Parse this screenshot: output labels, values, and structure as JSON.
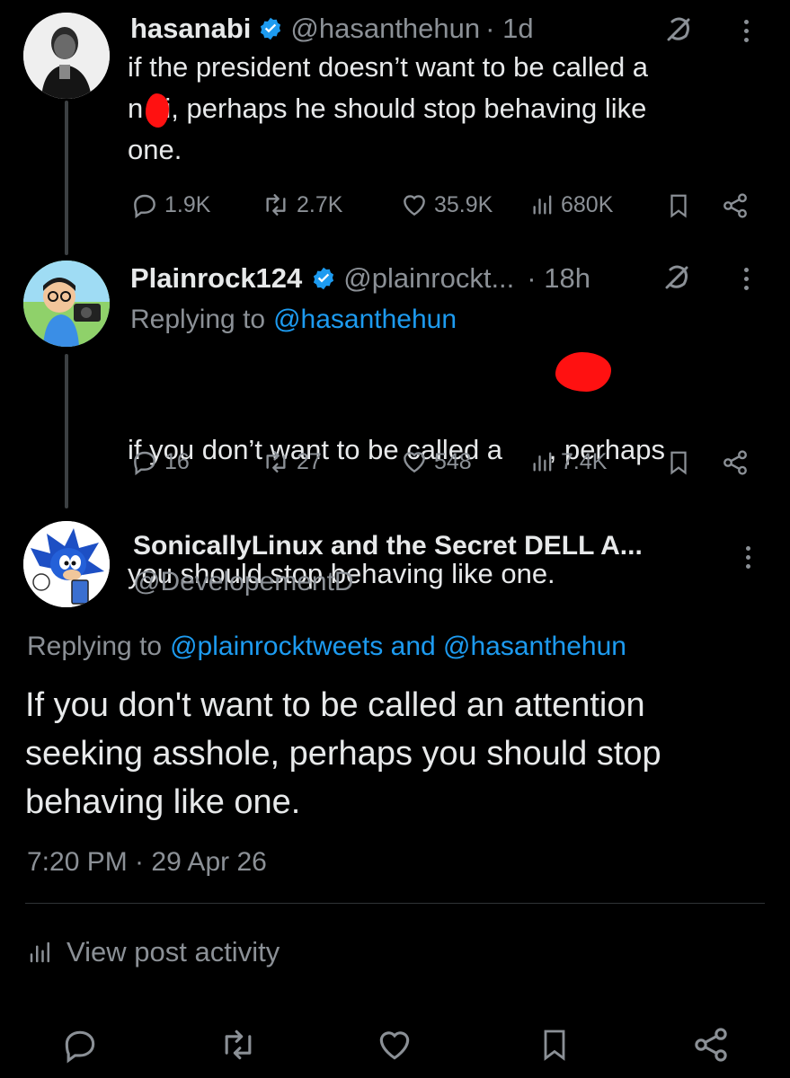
{
  "tweets": [
    {
      "name": "hasanabi",
      "handle": "@hasanthehun",
      "time": "· 1d",
      "text_lines": [
        "if the president doesn’t want to be called a",
        "n zi, perhaps he should stop behaving like",
        "one."
      ],
      "stats": {
        "replies": "1.9K",
        "reposts": "2.7K",
        "likes": "35.9K",
        "views": "680K"
      }
    },
    {
      "name": "Plainrock124",
      "handle": "@plainrockt...",
      "time": "· 18h",
      "replying_prefix": "Replying to",
      "replying_to": "@hasanthehun",
      "text_lines": [
        "if you don’t want to be called a      , perhaps",
        "you should stop behaving like one."
      ],
      "stats": {
        "replies": "16",
        "reposts": "27",
        "likes": "548",
        "views": "7.4K"
      }
    }
  ],
  "main_post": {
    "name": "SonicallyLinux and the Secret DELL A...",
    "handle": "@DevelopementD",
    "replying_prefix": "Replying to",
    "replying_to": "@plainrocktweets and @hasanthehun",
    "text_lines": [
      "If you don't want to be called an attention",
      "seeking asshole, perhaps you should stop",
      "behaving like one."
    ],
    "timestamp": "7:20 PM · 29 Apr 26"
  },
  "view_activity_label": "View post activity",
  "icons": [
    "reply-icon",
    "repost-icon",
    "like-icon",
    "views-icon",
    "bookmark-icon",
    "share-icon",
    "grok-icon",
    "more-icon",
    "verified-badge-icon"
  ],
  "colors": {
    "background": "#000000",
    "text": "#e7e9ea",
    "muted": "#8b9096",
    "link": "#1d9bf0",
    "verified": "#1d9bf0",
    "redaction": "#ff1111"
  }
}
